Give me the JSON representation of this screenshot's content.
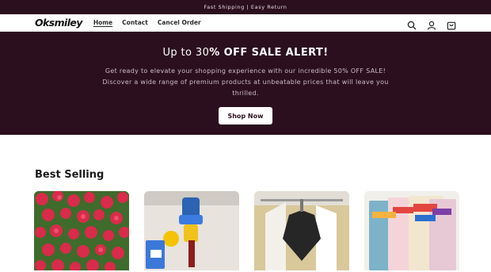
{
  "announcement": {
    "text": "Fast Shipping | Easy Return"
  },
  "header": {
    "logo": "Oksmiley",
    "nav": [
      {
        "label": "Home",
        "active": true
      },
      {
        "label": "Contact",
        "active": false
      },
      {
        "label": "Cancel Order",
        "active": false
      }
    ],
    "icons": [
      "search-icon",
      "account-icon",
      "cart-icon"
    ]
  },
  "hero": {
    "title_pre": "Up to 30",
    "title_bold": "% OFF SALE ALERT!",
    "text": "Get ready to elevate your shopping experience with our incredible 50% OFF SALE!   Discover a wide range of premium products at unbeatable prices that will leave you thrilled.",
    "button": "Shop Now"
  },
  "best_selling": {
    "title": "Best Selling",
    "products": [
      {
        "image": "red-roses-image"
      },
      {
        "image": "faucet-filter-image"
      },
      {
        "image": "hanging-garment-image"
      },
      {
        "image": "magic-books-image"
      }
    ]
  },
  "colors": {
    "brand_dark": "#2b0f1e",
    "white": "#ffffff"
  }
}
